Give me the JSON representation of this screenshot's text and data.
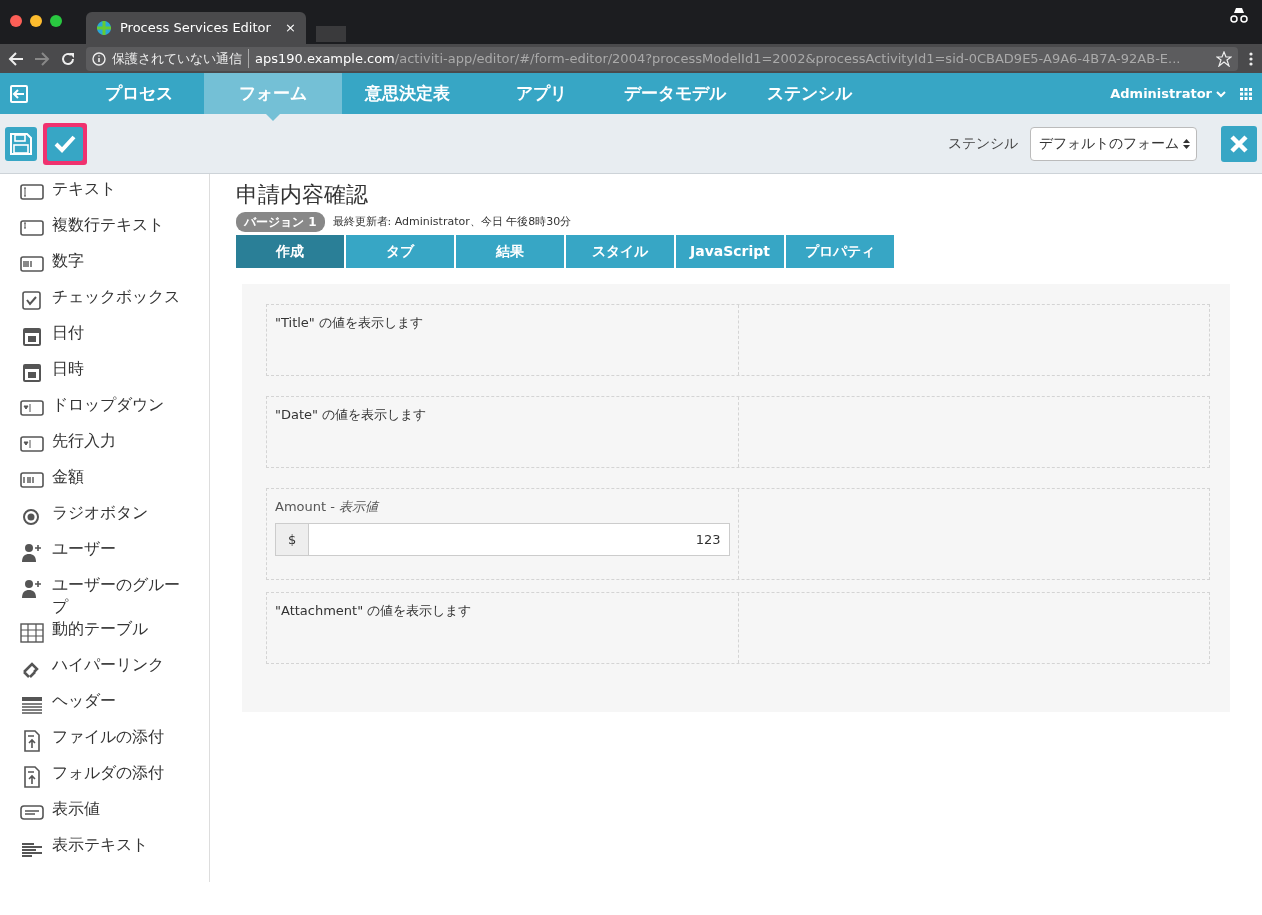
{
  "browser": {
    "tab_title": "Process Services Editor",
    "tab_close": "×",
    "address_security": "保護されていない通信",
    "address_host": "aps190.example.com",
    "address_path": "/activiti-app/editor/#/form-editor/2004?processModelId1=2002&processActivityId1=sid-0CBAD9E5-A9A6-4B7A-92AB-E..."
  },
  "nav": {
    "items": [
      {
        "label": "プロセス",
        "selected": false
      },
      {
        "label": "フォーム",
        "selected": true
      },
      {
        "label": "意思決定表",
        "selected": false
      },
      {
        "label": "アプリ",
        "selected": false
      },
      {
        "label": "データモデル",
        "selected": false
      },
      {
        "label": "ステンシル",
        "selected": false
      }
    ],
    "user": "Administrator"
  },
  "toolbar": {
    "validate_highlighted": true,
    "stencil_label": "ステンシル",
    "stencil_value": "デフォルトのフォーム"
  },
  "palette": [
    {
      "label": "テキスト"
    },
    {
      "label": "複数行テキスト"
    },
    {
      "label": "数字"
    },
    {
      "label": "チェックボックス"
    },
    {
      "label": "日付"
    },
    {
      "label": "日時"
    },
    {
      "label": "ドロップダウン"
    },
    {
      "label": "先行入力"
    },
    {
      "label": "金額"
    },
    {
      "label": "ラジオボタン"
    },
    {
      "label": "ユーザー"
    },
    {
      "label": "ユーザーのグループ"
    },
    {
      "label": "動的テーブル"
    },
    {
      "label": "ハイパーリンク"
    },
    {
      "label": "ヘッダー"
    },
    {
      "label": "ファイルの添付"
    },
    {
      "label": "フォルダの添付"
    },
    {
      "label": "表示値"
    },
    {
      "label": "表示テキスト"
    }
  ],
  "form": {
    "title": "申請内容確認",
    "version": "バージョン 1",
    "meta": "最終更新者: Administrator、今日 午後8時30分",
    "tabs": [
      {
        "label": "作成",
        "selected": true
      },
      {
        "label": "タブ",
        "selected": false
      },
      {
        "label": "結果",
        "selected": false
      },
      {
        "label": "スタイル",
        "selected": false
      },
      {
        "label": "JavaScript",
        "selected": false
      },
      {
        "label": "プロパティ",
        "selected": false
      }
    ],
    "rows": [
      {
        "kind": "display",
        "label": "\"Title\" の値を表示します"
      },
      {
        "kind": "display",
        "label": "\"Date\" の値を表示します"
      },
      {
        "kind": "amount",
        "label": "Amount - *表示値*",
        "prefix": "$",
        "value": "123"
      },
      {
        "kind": "display",
        "label": "\"Attachment\" の値を表示します"
      }
    ]
  }
}
